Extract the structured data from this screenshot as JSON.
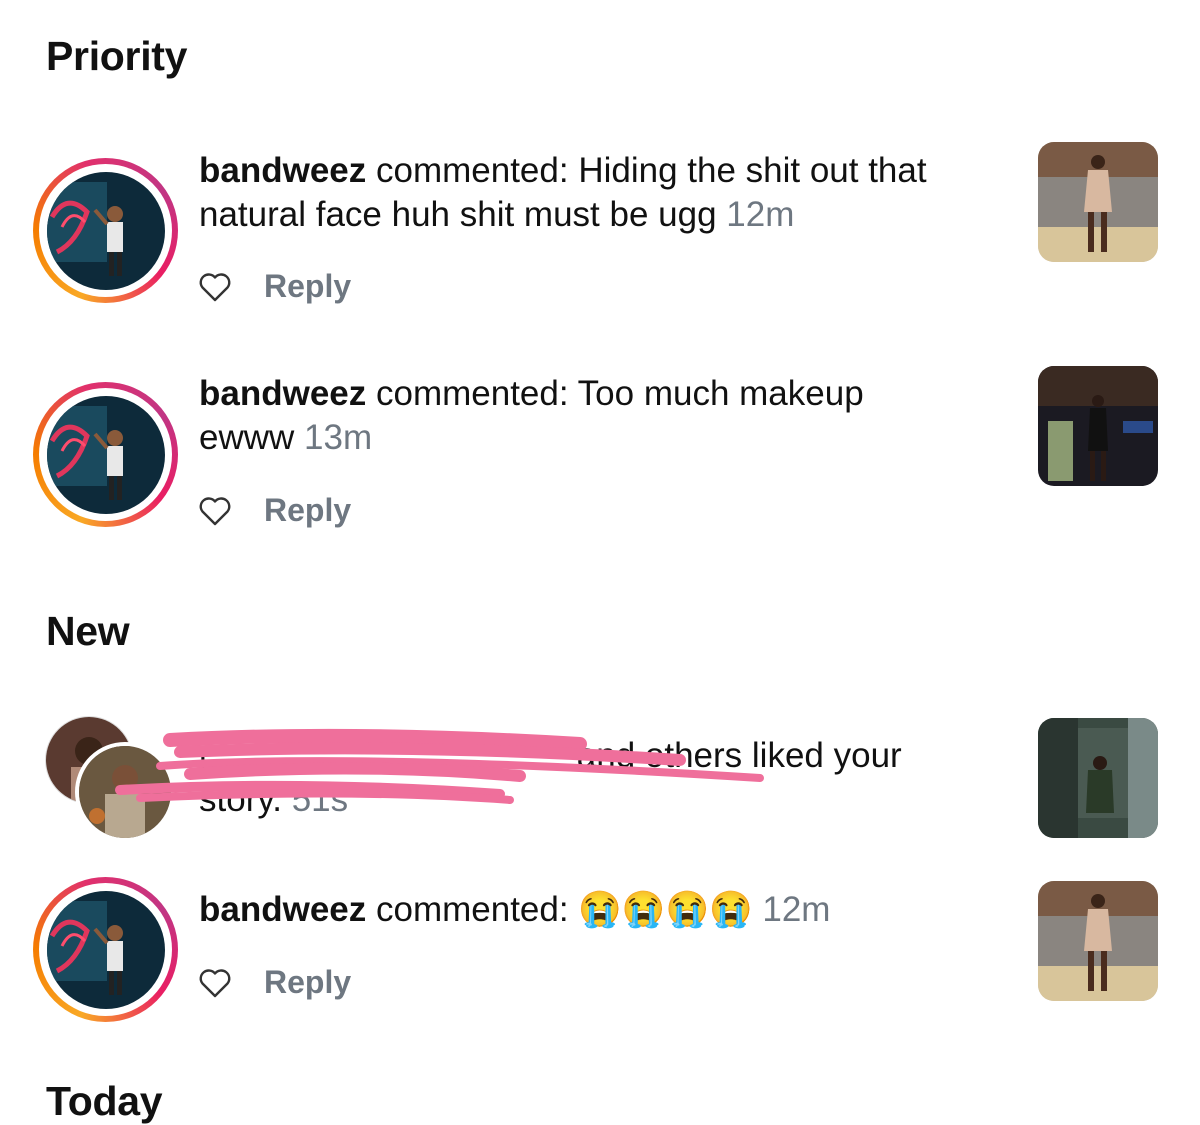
{
  "sections": {
    "priority": "Priority",
    "new": "New",
    "today": "Today"
  },
  "notifications": [
    {
      "user": "bandweez",
      "action": " commented: ",
      "comment": "Hiding the shit out that natural face huh shit must be ugg",
      "time": "12m",
      "reply_label": "Reply"
    },
    {
      "user": "bandweez",
      "action": " commented: ",
      "comment": "Too much makeup ewww",
      "time": "13m",
      "reply_label": "Reply"
    },
    {
      "redacted_prefix": "j",
      "text": "and others liked your",
      "text2": "story.",
      "time": "51s"
    },
    {
      "user": "bandweez",
      "action": " commented: ",
      "comment": "😭😭😭😭",
      "time": "12m",
      "reply_label": "Reply"
    }
  ],
  "icons": {
    "like": "heart-outline-icon",
    "avatar_ring": "story-ring-gradient"
  },
  "colors": {
    "ring_start": "#f9a825",
    "ring_end": "#e1306c",
    "muted": "#6e7781",
    "redaction": "#ef6f9b"
  }
}
